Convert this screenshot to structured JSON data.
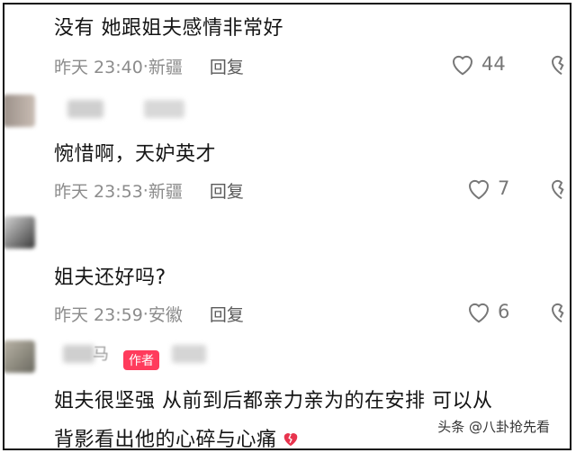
{
  "comments": [
    {
      "text": "没有 她跟姐夫感情非常好",
      "time": "昨天 23:40",
      "location": "新疆",
      "reply": "回复",
      "likes": "44"
    },
    {
      "text": "惋惜啊，天妒英才",
      "time": "昨天 23:53",
      "location": "新疆",
      "reply": "回复",
      "likes": "7"
    },
    {
      "text": "姐夫还好吗?",
      "time": "昨天 23:59",
      "location": "安徽",
      "reply": "回复",
      "likes": "6"
    },
    {
      "name": "马",
      "badge": "作者",
      "text_line1": "姐夫很坚强 从前到后都亲力亲为的在安排 可以从",
      "text_line2": "背影看出他的心碎与心痛"
    }
  ],
  "watermark": "头条 @八卦抢先看",
  "icons": {
    "like": "heart-outline-icon",
    "dislike": "broken-heart-outline-icon",
    "emoji": "broken-heart-emoji"
  },
  "colors": {
    "badge": "#ff3b5c",
    "meta": "#8c8c8c",
    "emoji": "#e8344e"
  }
}
